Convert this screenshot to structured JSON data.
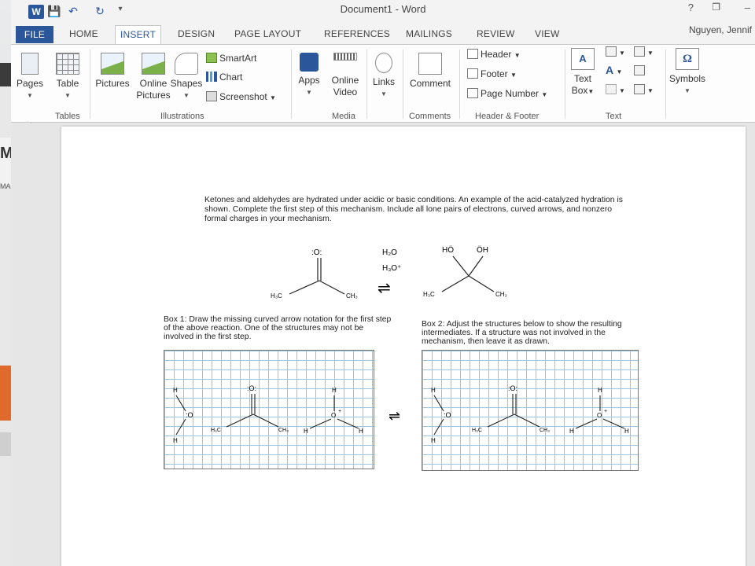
{
  "titlebar": {
    "title": "Document1 - Word",
    "help": "?",
    "restore": "❐",
    "minimize": "–"
  },
  "tabs": {
    "file": "FILE",
    "home": "HOME",
    "insert": "INSERT",
    "design": "DESIGN",
    "page_layout": "PAGE LAYOUT",
    "references": "REFERENCES",
    "mailings": "MAILINGS",
    "review": "REVIEW",
    "view": "VIEW",
    "user": "Nguyen, Jennif"
  },
  "ribbon": {
    "pages": "Pages",
    "table": "Table",
    "pictures": "Pictures",
    "online_pictures_1": "Online",
    "online_pictures_2": "Pictures",
    "shapes": "Shapes",
    "smartart": "SmartArt",
    "chart": "Chart",
    "screenshot": "Screenshot",
    "apps": "Apps",
    "online_video_1": "Online",
    "online_video_2": "Video",
    "links": "Links",
    "comment": "Comment",
    "header": "Header",
    "footer": "Footer",
    "page_number": "Page Number",
    "text_box_1": "Text",
    "text_box_2": "Box",
    "symbols": "Symbols",
    "groups": {
      "tables": "Tables",
      "illustrations": "Illustrations",
      "media": "Media",
      "comments": "Comments",
      "header_footer": "Header & Footer",
      "text": "Text"
    }
  },
  "background_window": {
    "text_mi": "Mi",
    "text_mar": "MAR"
  },
  "document": {
    "question": "Ketones and aldehydes are hydrated under acidic or basic conditions. An example of the acid-catalyzed hydration is shown. Complete the first step of this mechanism. Include all lone pairs of electrons, curved arrows, and nonzero formal charges in your mechanism.",
    "box1_caption": "Box 1: Draw the missing curved arrow notation for the first step of the above reaction. One of the structures may not be involved in the first step.",
    "box2_caption": "Box 2: Adjust the structures below to show the resulting intermediates. If a structure was not involved in the mechanism, then leave it as drawn.",
    "reaction": {
      "reagent_1": "H₂O",
      "reagent_2": "H₃O⁺",
      "equilibrium": "⇌",
      "carbonyl_o": ":O:",
      "h3c": "H₃C",
      "ch3": "CH₃",
      "product_ho": "HÖ",
      "product_oh": "ÖH"
    },
    "boxes": {
      "h": "H",
      "o_lone": ":O",
      "carbonyl_o": ":O:",
      "h3c": "H₃C",
      "ch3": "CH₃",
      "o_plus": "O",
      "plus": "+",
      "equilibrium": "⇌"
    }
  },
  "colors": {
    "word_blue": "#2b579a",
    "grid_line": "#9ec3da"
  }
}
